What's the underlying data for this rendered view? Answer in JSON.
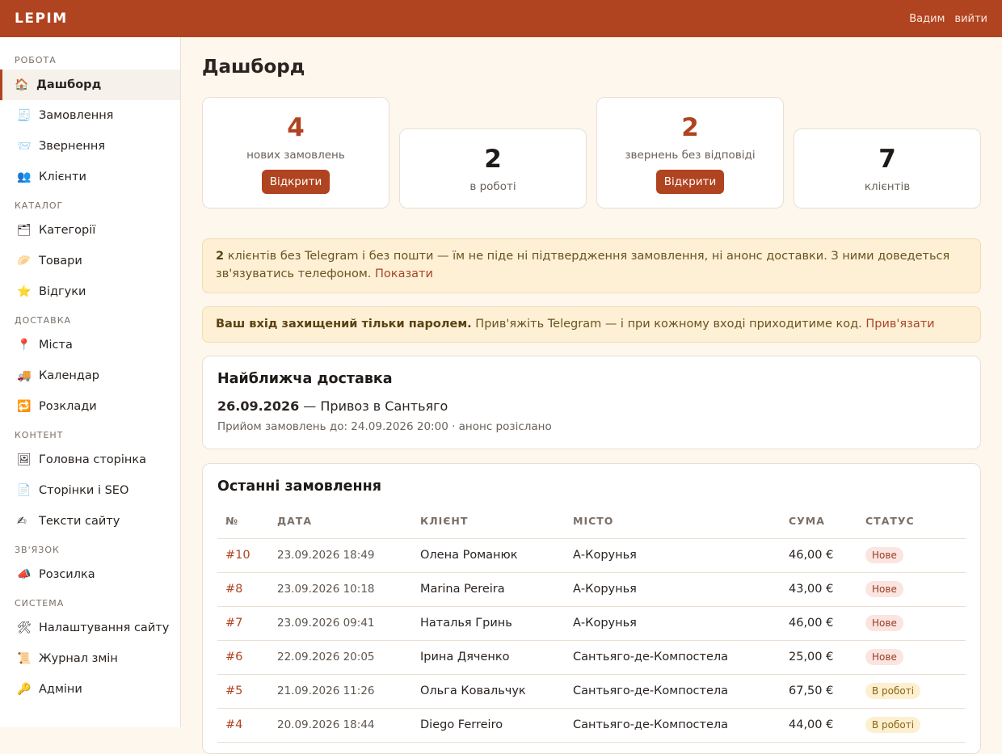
{
  "app": {
    "brand": "LEPIM",
    "user": "Вадим",
    "logout": "вийти"
  },
  "sidebar": [
    {
      "header": "РОБОТА",
      "items": [
        {
          "icon": "🏠",
          "label": "Дашборд",
          "active": true
        },
        {
          "icon": "🧾",
          "label": "Замовлення"
        },
        {
          "icon": "📨",
          "label": "Звернення"
        },
        {
          "icon": "👥",
          "label": "Клієнти"
        }
      ]
    },
    {
      "header": "КАТАЛОГ",
      "items": [
        {
          "icon": "🗂",
          "label": "Категорії"
        },
        {
          "icon": "🥟",
          "label": "Товари"
        },
        {
          "icon": "⭐",
          "label": "Відгуки"
        }
      ]
    },
    {
      "header": "ДОСТАВКА",
      "items": [
        {
          "icon": "📍",
          "label": "Міста"
        },
        {
          "icon": "🚚",
          "label": "Календар"
        },
        {
          "icon": "🔁",
          "label": "Розклади"
        }
      ]
    },
    {
      "header": "КОНТЕНТ",
      "items": [
        {
          "icon": "🖼",
          "label": "Головна сторінка"
        },
        {
          "icon": "📄",
          "label": "Сторінки і SEO"
        },
        {
          "icon": "✍",
          "label": "Тексти сайту"
        }
      ]
    },
    {
      "header": "ЗВ'ЯЗОК",
      "items": [
        {
          "icon": "📣",
          "label": "Розсилка"
        }
      ]
    },
    {
      "header": "СИСТЕМА",
      "items": [
        {
          "icon": "🛠",
          "label": "Налаштування сайту"
        },
        {
          "icon": "📜",
          "label": "Журнал змін"
        },
        {
          "icon": "🔑",
          "label": "Адміни"
        }
      ]
    }
  ],
  "page": {
    "title": "Дашборд"
  },
  "stats": [
    {
      "value": "4",
      "label": "нових замовлень",
      "button": "Відкрити",
      "accent": true
    },
    {
      "value": "2",
      "label": "в роботі"
    },
    {
      "value": "2",
      "label": "звернень без відповіді",
      "button": "Відкрити",
      "accent": true
    },
    {
      "value": "7",
      "label": "клієнтів"
    }
  ],
  "alerts": {
    "telegram_missing": {
      "count": "2",
      "text": " клієнтів без Telegram і без пошти — їм не піде ні підтвердження замовлення, ні анонс доставки. З ними доведеться зв'язуватись телефоном. ",
      "link": "Показати"
    },
    "password_only": {
      "bold": "Ваш вхід захищений тільки паролем.",
      "text": " Прив'яжіть Telegram — і при кожному вході приходитиме код. ",
      "link": "Прив'язати"
    }
  },
  "delivery": {
    "title": "Найближча доставка",
    "date": "26.09.2026",
    "name": " — Привоз в Сантьяго",
    "meta": "Прийом замовлень до: 24.09.2026 20:00 · анонс розіслано"
  },
  "orders": {
    "title": "Останні замовлення",
    "columns": [
      "№",
      "ДАТА",
      "КЛІЄНТ",
      "МІСТО",
      "СУМА",
      "СТАТУС"
    ],
    "rows": [
      {
        "id": "#10",
        "date": "23.09.2026 18:49",
        "client": "Олена Романюк",
        "city": "А-Корунья",
        "sum": "46,00 €",
        "status": "Нове",
        "status_kind": "new"
      },
      {
        "id": "#8",
        "date": "23.09.2026 10:18",
        "client": "Marina Pereira",
        "city": "А-Корунья",
        "sum": "43,00 €",
        "status": "Нове",
        "status_kind": "new"
      },
      {
        "id": "#7",
        "date": "23.09.2026 09:41",
        "client": "Наталья Гринь",
        "city": "А-Корунья",
        "sum": "46,00 €",
        "status": "Нове",
        "status_kind": "new"
      },
      {
        "id": "#6",
        "date": "22.09.2026 20:05",
        "client": "Ірина Дяченко",
        "city": "Сантьяго-де-Компостела",
        "sum": "25,00 €",
        "status": "Нове",
        "status_kind": "new"
      },
      {
        "id": "#5",
        "date": "21.09.2026 11:26",
        "client": "Ольга Ковальчук",
        "city": "Сантьяго-де-Компостела",
        "sum": "67,50 €",
        "status": "В роботі",
        "status_kind": "work"
      },
      {
        "id": "#4",
        "date": "20.09.2026 18:44",
        "client": "Diego Ferreiro",
        "city": "Сантьяго-де-Компостела",
        "sum": "44,00 €",
        "status": "В роботі",
        "status_kind": "work"
      }
    ]
  }
}
